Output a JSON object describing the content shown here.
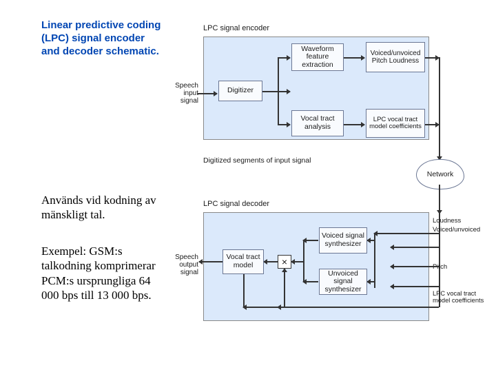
{
  "title": "Linear predictive coding (LPC) signal encoder and decoder schematic.",
  "body_p1": "Används vid kodning av mänskligt tal.",
  "body_p2": "Exempel: GSM:s talkodning komprimerar PCM:s ursprungliga 64 000 bps till 13 000 bps.",
  "encoder": {
    "header": "LPC signal encoder",
    "input": "Speech input signal",
    "digitizer": "Digitizer",
    "wfe": "Waveform feature extraction",
    "vta": "Vocal tract analysis",
    "vup": "Voiced/unvoiced Pitch Loudness",
    "coef": "LPC vocal tract model coefficients",
    "midlabel": "Digitized segments of input signal",
    "network": "Network"
  },
  "decoder": {
    "header": "LPC signal decoder",
    "output": "Speech output signal",
    "vtm": "Vocal tract model",
    "vss": "Voiced signal synthesizer",
    "uvss": "Unvoiced signal synthesizer",
    "loud": "Loudness",
    "vuv": "Voiced/unvoiced",
    "pitch": "Pitch",
    "coef": "LPC vocal tract model coefficients",
    "combine": "×"
  }
}
